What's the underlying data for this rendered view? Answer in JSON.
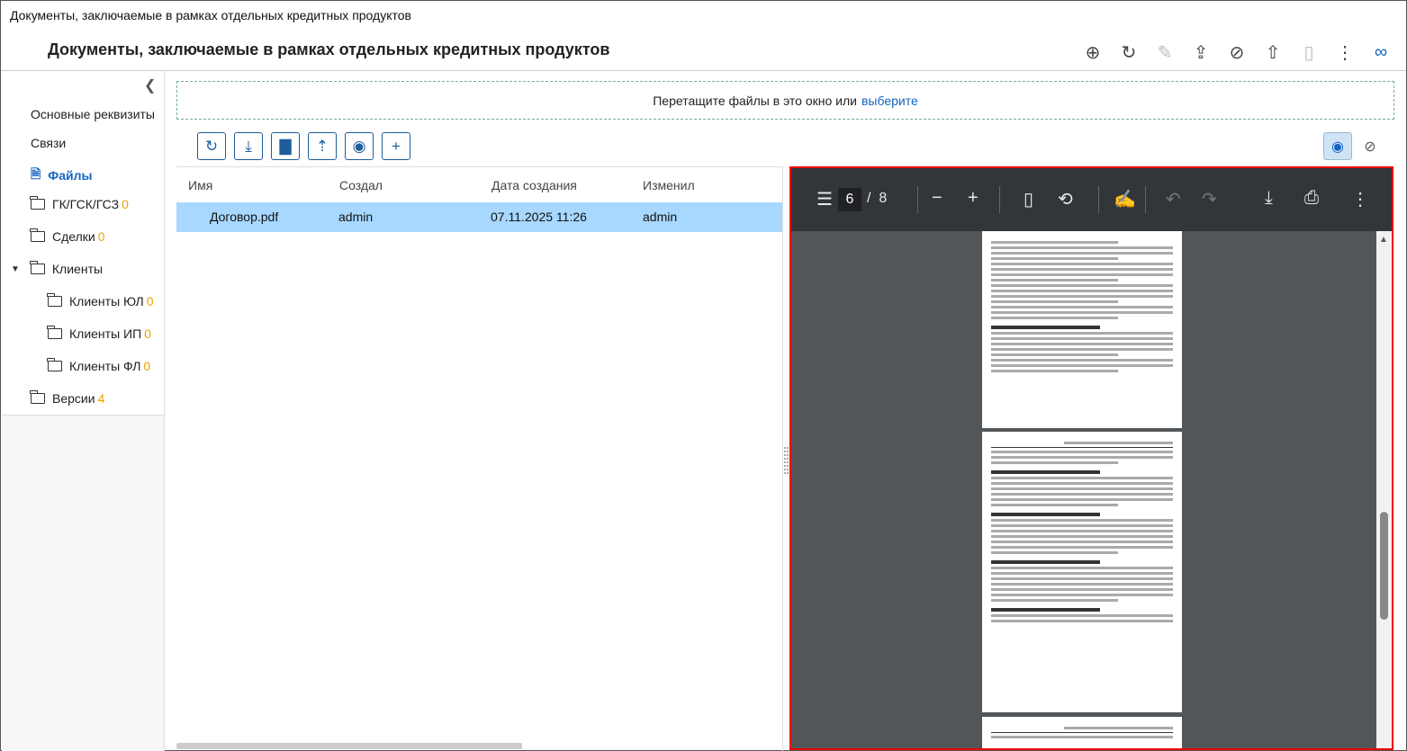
{
  "window": {
    "title": "Документы, заключаемые в рамках отдельных кредитных продуктов"
  },
  "header": {
    "title": "Документы, заключаемые в рамках отдельных кредитных продуктов",
    "actions": [
      {
        "name": "add-circle-icon",
        "glyph": "⊕",
        "disabled": false
      },
      {
        "name": "refresh-icon",
        "glyph": "↻",
        "disabled": false
      },
      {
        "name": "edit-document-icon",
        "glyph": "✎",
        "disabled": true
      },
      {
        "name": "open-external-icon",
        "glyph": "⇪",
        "disabled": false
      },
      {
        "name": "no-document-icon",
        "glyph": "⊘",
        "disabled": false
      },
      {
        "name": "folder-upload-icon",
        "glyph": "⇧",
        "disabled": false
      },
      {
        "name": "delete-icon",
        "glyph": "🗑",
        "disabled": true
      },
      {
        "name": "more-icon",
        "glyph": "⋮",
        "disabled": false
      },
      {
        "name": "link-icon",
        "glyph": "🔗",
        "disabled": false
      }
    ]
  },
  "sidebar": {
    "items": [
      {
        "label": "Основные реквизиты",
        "count": ""
      },
      {
        "label": "Связи",
        "count": ""
      },
      {
        "label": "Файлы",
        "count": ""
      },
      {
        "label": "ГК/ГСК/ГСЗ",
        "count": "0"
      },
      {
        "label": "Сделки",
        "count": "0"
      },
      {
        "label": "Клиенты",
        "count": ""
      },
      {
        "label": "Клиенты ЮЛ",
        "count": "0"
      },
      {
        "label": "Клиенты ИП",
        "count": "0"
      },
      {
        "label": "Клиенты ФЛ",
        "count": "0"
      },
      {
        "label": "Версии",
        "count": "4"
      }
    ]
  },
  "dropzone": {
    "text": "Перетащите файлы в это окно или",
    "link": "выберите"
  },
  "table": {
    "columns": [
      "Имя",
      "Создал",
      "Дата создания",
      "Изменил"
    ],
    "rows": [
      {
        "name": "Договор.pdf",
        "created_by": "admin",
        "created_at": "07.11.2025 11:26",
        "modified_by": "admin"
      }
    ]
  },
  "viewer": {
    "current_page": "6",
    "separator": "/",
    "total_pages": "8"
  },
  "colors": {
    "accent": "#1565c0",
    "selected_row": "#a8d8ff",
    "count": "#f0a000",
    "viewer_border": "#e00000"
  }
}
